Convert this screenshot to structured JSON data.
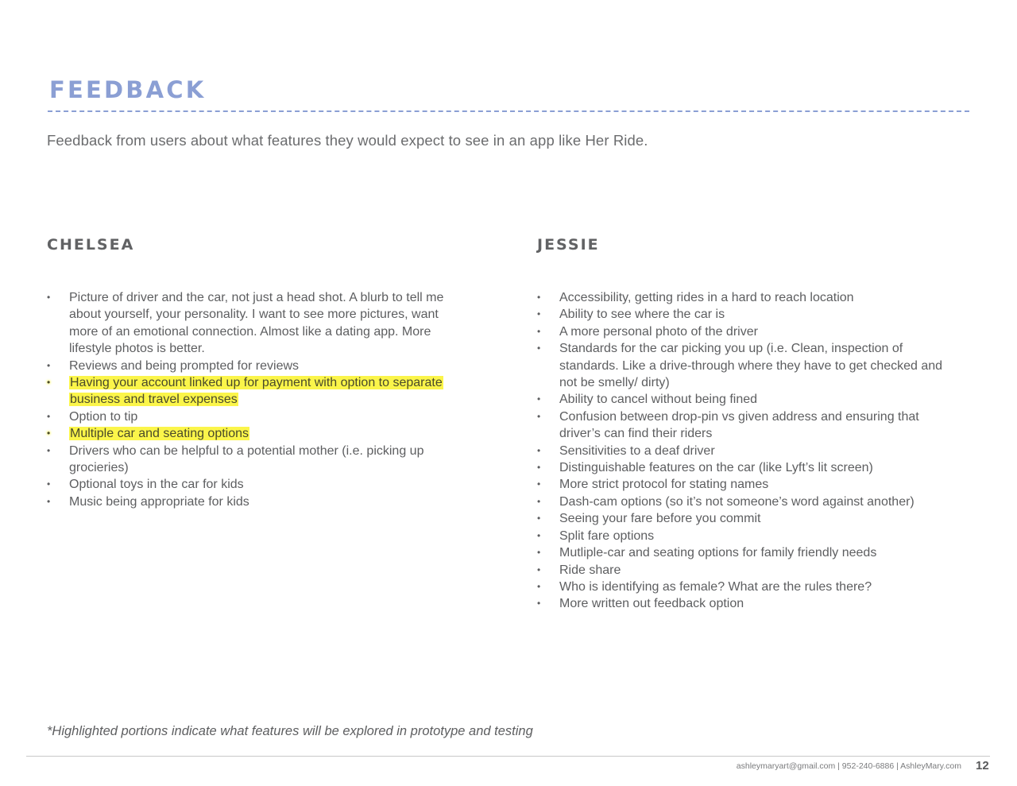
{
  "page": {
    "title": "FEEDBACK",
    "subtitle": "Feedback from users about what features they would expect to see in an app like Her Ride.",
    "accent_color": "#8b9fd4",
    "highlight_color": "#fbf54a"
  },
  "columns": [
    {
      "name": "CHELSEA",
      "items": [
        {
          "text": "Picture of driver and the car, not just a head shot.  A blurb to tell me about yourself, your personality. I want to see more pictures, want more of an emotional connection. Almost like a dating app. More lifestyle photos is better.",
          "highlighted": false
        },
        {
          "text": "Reviews and being prompted for reviews",
          "highlighted": false
        },
        {
          "text": "Having your account linked up for payment with option to separate business and travel expenses",
          "highlighted": true
        },
        {
          "text": "Option to tip",
          "highlighted": false
        },
        {
          "text": "Multiple car and seating options",
          "highlighted": true
        },
        {
          "text": "Drivers who can be helpful to a potential mother (i.e. picking up grocieries)",
          "highlighted": false
        },
        {
          "text": "Optional toys in the car for kids",
          "highlighted": false
        },
        {
          "text": "Music being appropriate for kids",
          "highlighted": false
        }
      ]
    },
    {
      "name": "JESSIE",
      "items": [
        {
          "text": "Accessibility, getting rides in a hard to reach location",
          "highlighted": false
        },
        {
          "text": "Ability to see where the car is",
          "highlighted": false
        },
        {
          "text": "A more personal photo of the driver",
          "highlighted": false
        },
        {
          "text": "Standards for the car picking you up (i.e. Clean, inspection of standards. Like a drive-through where they have to get checked and  not be smelly/ dirty)",
          "highlighted": false
        },
        {
          "text": "Ability to cancel without being fined",
          "highlighted": false
        },
        {
          "text": "Confusion between drop-pin vs given address and ensuring that driver’s can find their riders",
          "highlighted": false
        },
        {
          "text": "Sensitivities to a deaf driver",
          "highlighted": false
        },
        {
          "text": "Distinguishable features on the car (like Lyft’s lit screen)",
          "highlighted": false
        },
        {
          "text": "More strict protocol for stating names",
          "highlighted": false
        },
        {
          "text": "Dash-cam options (so it’s not someone’s word against another)",
          "highlighted": false
        },
        {
          "text": "Seeing your fare before you commit",
          "highlighted": false
        },
        {
          "text": "Split fare options",
          "highlighted": false
        },
        {
          "text": "Mutliple-car and seating options for family friendly needs",
          "highlighted": false
        },
        {
          "text": "Ride share",
          "highlighted": false
        },
        {
          "text": "Who is identifying as female? What are the rules there?",
          "highlighted": false
        },
        {
          "text": "More written out feedback option",
          "highlighted": false
        }
      ]
    }
  ],
  "bullet_glyph": "•",
  "note": "*Highlighted portions indicate what features will be explored in prototype and testing",
  "footer": {
    "contact": "ashleymaryart@gmail.com | 952-240-6886 | AshleyMary.com",
    "page_number": "12"
  }
}
